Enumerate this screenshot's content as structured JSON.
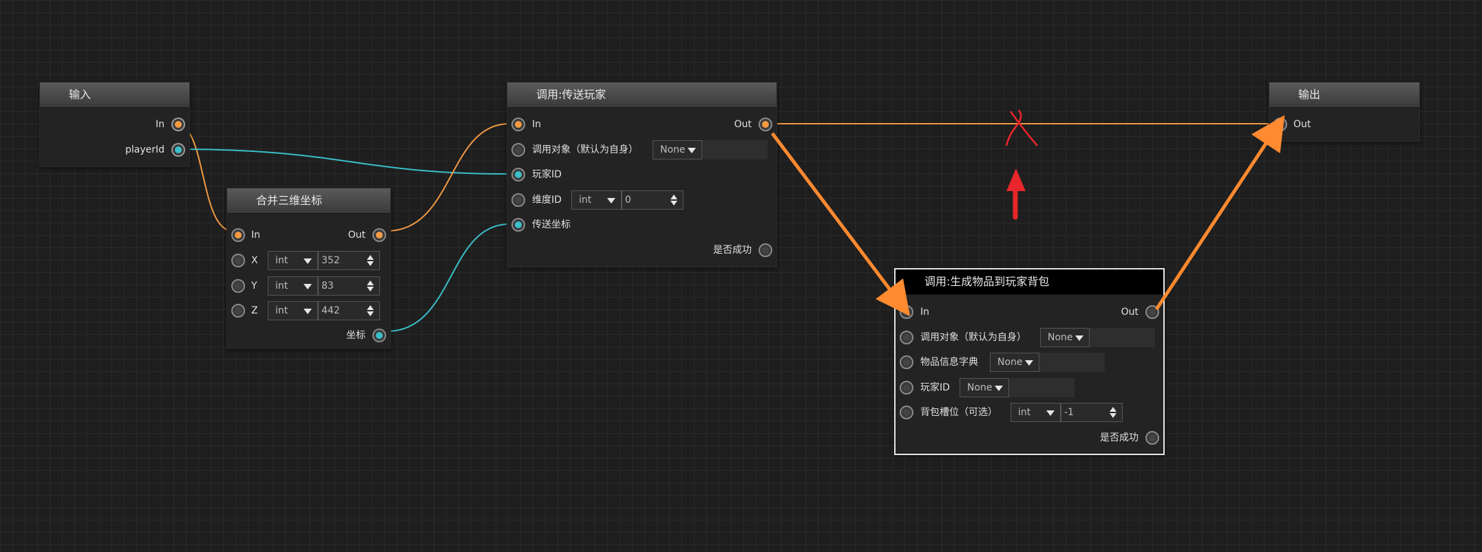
{
  "colors": {
    "exec": "#f39a44",
    "data": "#3bbfca",
    "empty": "#444444",
    "highlight_wire": "#ff8a30",
    "mark": "#e8262b"
  },
  "nodes": {
    "input": {
      "title": "输入",
      "ports": {
        "in": "In",
        "player_id": "playerId"
      }
    },
    "merge": {
      "title": "合并三维坐标",
      "ports": {
        "in": "In",
        "out": "Out",
        "x": "X",
        "y": "Y",
        "z": "Z",
        "coord": "坐标"
      },
      "x_type": "int",
      "x_value": "352",
      "y_type": "int",
      "y_value": "83",
      "z_type": "int",
      "z_value": "442"
    },
    "teleport": {
      "title": "调用:传送玩家",
      "ports": {
        "in": "In",
        "out": "Out",
        "target": "调用对象（默认为自身）",
        "player_id": "玩家ID",
        "dimension_id": "维度ID",
        "teleport_coord": "传送坐标",
        "success": "是否成功"
      },
      "target_option": "None",
      "dimension_type": "int",
      "dimension_value": "0"
    },
    "output": {
      "title": "输出",
      "ports": {
        "out": "Out"
      }
    },
    "give_item": {
      "title": "调用:生成物品到玩家背包",
      "ports": {
        "in": "In",
        "out": "Out",
        "target": "调用对象（默认为自身）",
        "item_dict": "物品信息字典",
        "player_id": "玩家ID",
        "slot": "背包槽位（可选）",
        "success": "是否成功"
      },
      "target_option": "None",
      "item_dict_option": "None",
      "player_id_option": "None",
      "slot_type": "int",
      "slot_value": "-1"
    }
  }
}
